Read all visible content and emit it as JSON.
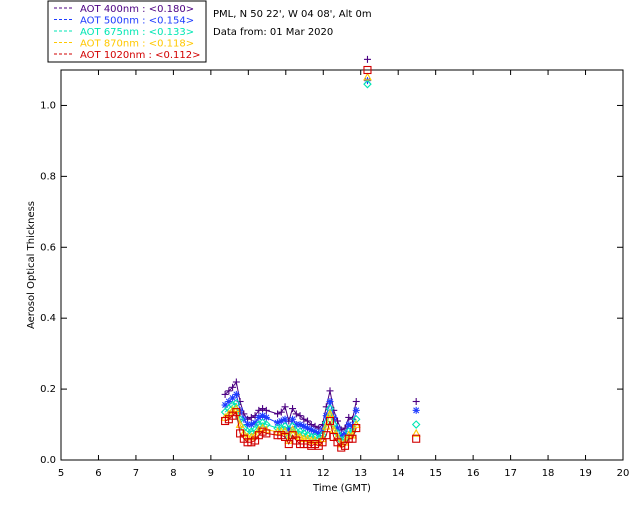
{
  "chart_data": {
    "type": "scatter",
    "xlabel": "Time (GMT)",
    "ylabel": "Aerosol Optical Thickness",
    "xlim": [
      5,
      20
    ],
    "ylim": [
      0,
      1.1
    ],
    "x_ticks": [
      "5",
      "6",
      "7",
      "8",
      "9",
      "10",
      "11",
      "12",
      "13",
      "14",
      "15",
      "16",
      "17",
      "18",
      "19",
      "20"
    ],
    "y_ticks": [
      "0.0",
      "0.2",
      "0.4",
      "0.6",
      "0.8",
      "1.0"
    ],
    "info": {
      "site": "PML, N 50 22', W 04 08', Alt 0m",
      "date": "Data from: 01 Mar 2020"
    },
    "x": [
      9.38,
      9.48,
      9.58,
      9.68,
      9.78,
      9.88,
      9.98,
      10.08,
      10.18,
      10.28,
      10.38,
      10.48,
      10.78,
      10.88,
      10.98,
      11.08,
      11.18,
      11.28,
      11.38,
      11.48,
      11.58,
      11.68,
      11.78,
      11.88,
      11.98,
      12.08,
      12.18,
      12.28,
      12.38,
      12.48,
      12.58,
      12.68,
      12.78,
      12.88,
      13.18,
      14.48
    ],
    "series": [
      {
        "name": "AOT  400nm : <0.180>",
        "color": "#4b0082",
        "marker": "plus",
        "values": [
          0.185,
          0.195,
          0.205,
          0.22,
          0.165,
          0.13,
          0.115,
          0.12,
          0.125,
          0.14,
          0.145,
          0.14,
          0.13,
          0.135,
          0.15,
          0.11,
          0.145,
          0.13,
          0.125,
          0.115,
          0.11,
          0.1,
          0.095,
          0.09,
          0.1,
          0.15,
          0.195,
          0.14,
          0.11,
          0.085,
          0.09,
          0.12,
          0.115,
          0.165,
          1.13,
          0.165
        ]
      },
      {
        "name": "AOT  500nm : <0.154>",
        "color": "#1e3cff",
        "marker": "star",
        "values": [
          0.155,
          0.165,
          0.175,
          0.185,
          0.14,
          0.115,
          0.1,
          0.1,
          0.105,
          0.12,
          0.125,
          0.12,
          0.105,
          0.11,
          0.115,
          0.085,
          0.115,
          0.1,
          0.1,
          0.095,
          0.09,
          0.085,
          0.08,
          0.075,
          0.085,
          0.125,
          0.165,
          0.12,
          0.09,
          0.07,
          0.075,
          0.1,
          0.095,
          0.14,
          1.07,
          0.14
        ]
      },
      {
        "name": "AOT  675nm : <0.133>",
        "color": "#00e6b4",
        "marker": "diamond",
        "values": [
          0.135,
          0.145,
          0.155,
          0.16,
          0.115,
          0.09,
          0.08,
          0.08,
          0.085,
          0.1,
          0.105,
          0.1,
          0.09,
          0.09,
          0.095,
          0.065,
          0.095,
          0.08,
          0.08,
          0.075,
          0.07,
          0.065,
          0.065,
          0.06,
          0.07,
          0.105,
          0.145,
          0.1,
          0.075,
          0.055,
          0.06,
          0.08,
          0.08,
          0.115,
          1.06,
          0.1
        ]
      },
      {
        "name": "AOT  870nm : <0.118>",
        "color": "#ffc800",
        "marker": "triangle",
        "values": [
          0.12,
          0.13,
          0.14,
          0.145,
          0.1,
          0.075,
          0.065,
          0.065,
          0.07,
          0.085,
          0.09,
          0.085,
          0.08,
          0.08,
          0.08,
          0.055,
          0.085,
          0.07,
          0.065,
          0.06,
          0.06,
          0.055,
          0.055,
          0.05,
          0.06,
          0.095,
          0.13,
          0.085,
          0.065,
          0.045,
          0.05,
          0.07,
          0.07,
          0.1,
          1.08,
          0.075
        ]
      },
      {
        "name": "AOT 1020nm : <0.112>",
        "color": "#d20000",
        "marker": "square",
        "values": [
          0.11,
          0.115,
          0.125,
          0.135,
          0.075,
          0.06,
          0.05,
          0.05,
          0.055,
          0.07,
          0.08,
          0.075,
          0.07,
          0.07,
          0.065,
          0.045,
          0.07,
          0.055,
          0.045,
          0.045,
          0.045,
          0.04,
          0.045,
          0.04,
          0.05,
          0.07,
          0.11,
          0.065,
          0.05,
          0.035,
          0.04,
          0.06,
          0.06,
          0.09,
          1.1,
          0.06
        ]
      }
    ]
  }
}
